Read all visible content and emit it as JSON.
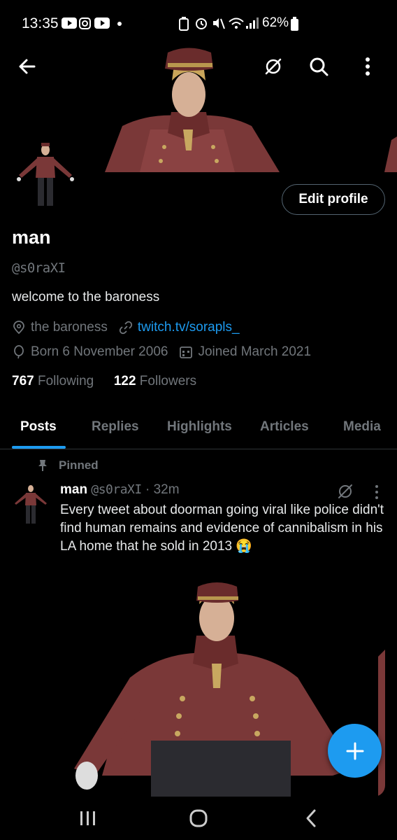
{
  "status_bar": {
    "time": "13:35",
    "battery_percent": "62%"
  },
  "profile": {
    "display_name": "man",
    "handle": "@s0raXI",
    "bio": "welcome to the baroness",
    "location": "the baroness",
    "website": "twitch.tv/sorapls_",
    "birthday": "Born 6 November 2006",
    "joined": "Joined March 2021",
    "following_count": "767",
    "following_label": "Following",
    "followers_count": "122",
    "followers_label": "Followers",
    "edit_label": "Edit profile"
  },
  "tabs": [
    {
      "label": "Posts",
      "active": true
    },
    {
      "label": "Replies"
    },
    {
      "label": "Highlights"
    },
    {
      "label": "Articles"
    },
    {
      "label": "Media"
    }
  ],
  "pinned_tweet": {
    "pinned_label": "Pinned",
    "author_name": "man",
    "author_handle": "@s0raXI",
    "time": "· 32m",
    "text": "Every tweet about doorman going viral like police didn't find human remains and evidence of cannibalism in his LA home that he sold in 2013 😭"
  },
  "colors": {
    "accent": "#1d9bf0",
    "background": "#000000",
    "secondary_text": "#71767b"
  },
  "icons": {
    "back": "arrow-left-icon",
    "grok": "grok-icon",
    "search": "search-icon",
    "more": "more-vertical-icon",
    "location": "location-pin-icon",
    "link": "link-icon",
    "birthday": "balloon-icon",
    "calendar": "calendar-icon",
    "pin": "pin-icon",
    "compose": "plus-icon"
  }
}
